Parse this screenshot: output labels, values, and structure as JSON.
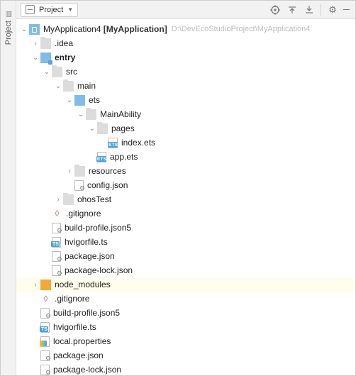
{
  "sidebar": {
    "label": "Project"
  },
  "toolbar": {
    "title": "Project",
    "btn_target": "Select Opened File",
    "btn_expand": "Expand All",
    "btn_collapse": "Collapse All",
    "btn_settings": "Show Options Menu"
  },
  "project": {
    "name": "MyApplication4",
    "context": "[MyApplication]",
    "path": "D:\\DevEcoStudioProject\\MyApplication4"
  },
  "tree": {
    "idea": ".idea",
    "entry": "entry",
    "src": "src",
    "main": "main",
    "ets": "ets",
    "mainAbility": "MainAbility",
    "pages": "pages",
    "index_ets": "index.ets",
    "app_ets": "app.ets",
    "resources": "resources",
    "config_json": "config.json",
    "ohosTest": "ohosTest",
    "gitignore": ".gitignore",
    "build_profile": "build-profile.json5",
    "hvigorfile": "hvigorfile.ts",
    "package_json": "package.json",
    "package_lock": "package-lock.json",
    "node_modules": "node_modules",
    "local_properties": "local.properties"
  }
}
